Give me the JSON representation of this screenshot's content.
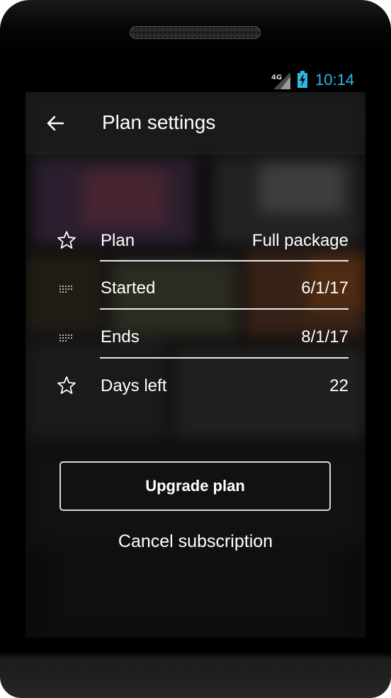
{
  "status_bar": {
    "network_label": "4G",
    "time": "10:14",
    "accent_color": "#33b5e5"
  },
  "app_bar": {
    "title": "Plan settings",
    "back_icon": "arrow-left-icon"
  },
  "plan_details": [
    {
      "icon": "star-outline-icon",
      "label": "Plan",
      "value": "Full package"
    },
    {
      "icon": "calendar-dots-icon",
      "label": "Started",
      "value": "6/1/17"
    },
    {
      "icon": "calendar-dots-icon",
      "label": "Ends",
      "value": "8/1/17"
    },
    {
      "icon": "star-outline-icon",
      "label": "Days left",
      "value": "22"
    }
  ],
  "actions": {
    "upgrade_label": "Upgrade plan",
    "cancel_label": "Cancel subscription"
  }
}
